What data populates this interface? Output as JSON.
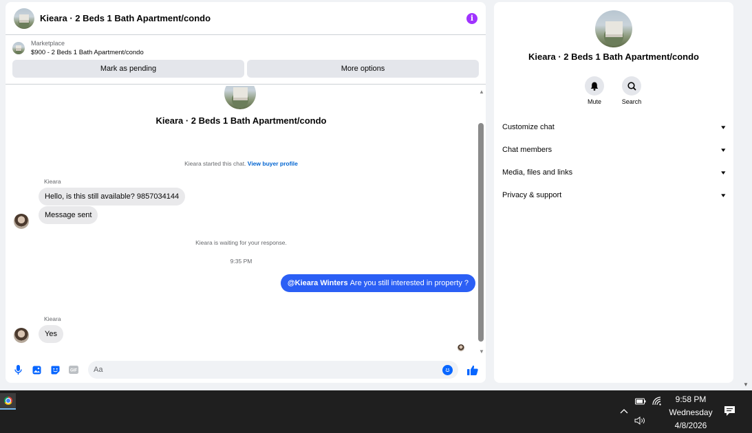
{
  "chat": {
    "title": "Kieara · 2 Beds 1 Bath Apartment/condo",
    "marketplace_label": "Marketplace",
    "listing": "$900 - 2 Beds 1 Bath Apartment/condo",
    "mark_pending": "Mark as pending",
    "more_options": "More options",
    "intro_title": "Kieara · 2 Beds 1 Bath Apartment/condo",
    "started_text": "Kieara started this chat.",
    "buyer_profile_link": "View buyer profile",
    "messages": [
      {
        "sender": "Kieara",
        "text": "Hello, is this still available? 9857034144"
      },
      {
        "text": "Message sent"
      }
    ],
    "waiting_text": "Kieara is waiting for your response.",
    "timestamp": "9:35 PM",
    "outgoing": {
      "mention": "@Kieara Winters",
      "text": "Are you still interested in property ?"
    },
    "reply": {
      "sender": "Kieara",
      "text": "Yes"
    },
    "input_placeholder": "Aa",
    "gif_label": "GIF"
  },
  "info": {
    "title": "Kieara · 2 Beds 1 Bath Apartment/condo",
    "mute_label": "Mute",
    "search_label": "Search",
    "sections": [
      "Customize chat",
      "Chat members",
      "Media, files and links",
      "Privacy & support"
    ]
  },
  "taskbar": {
    "time": "9:58 PM",
    "day": "Wednesday",
    "date": "4/8/2026"
  },
  "colors": {
    "accent": "#0866ff",
    "outgoing_bubble": "#2b5ff5",
    "info_icon": "#a033ff"
  }
}
